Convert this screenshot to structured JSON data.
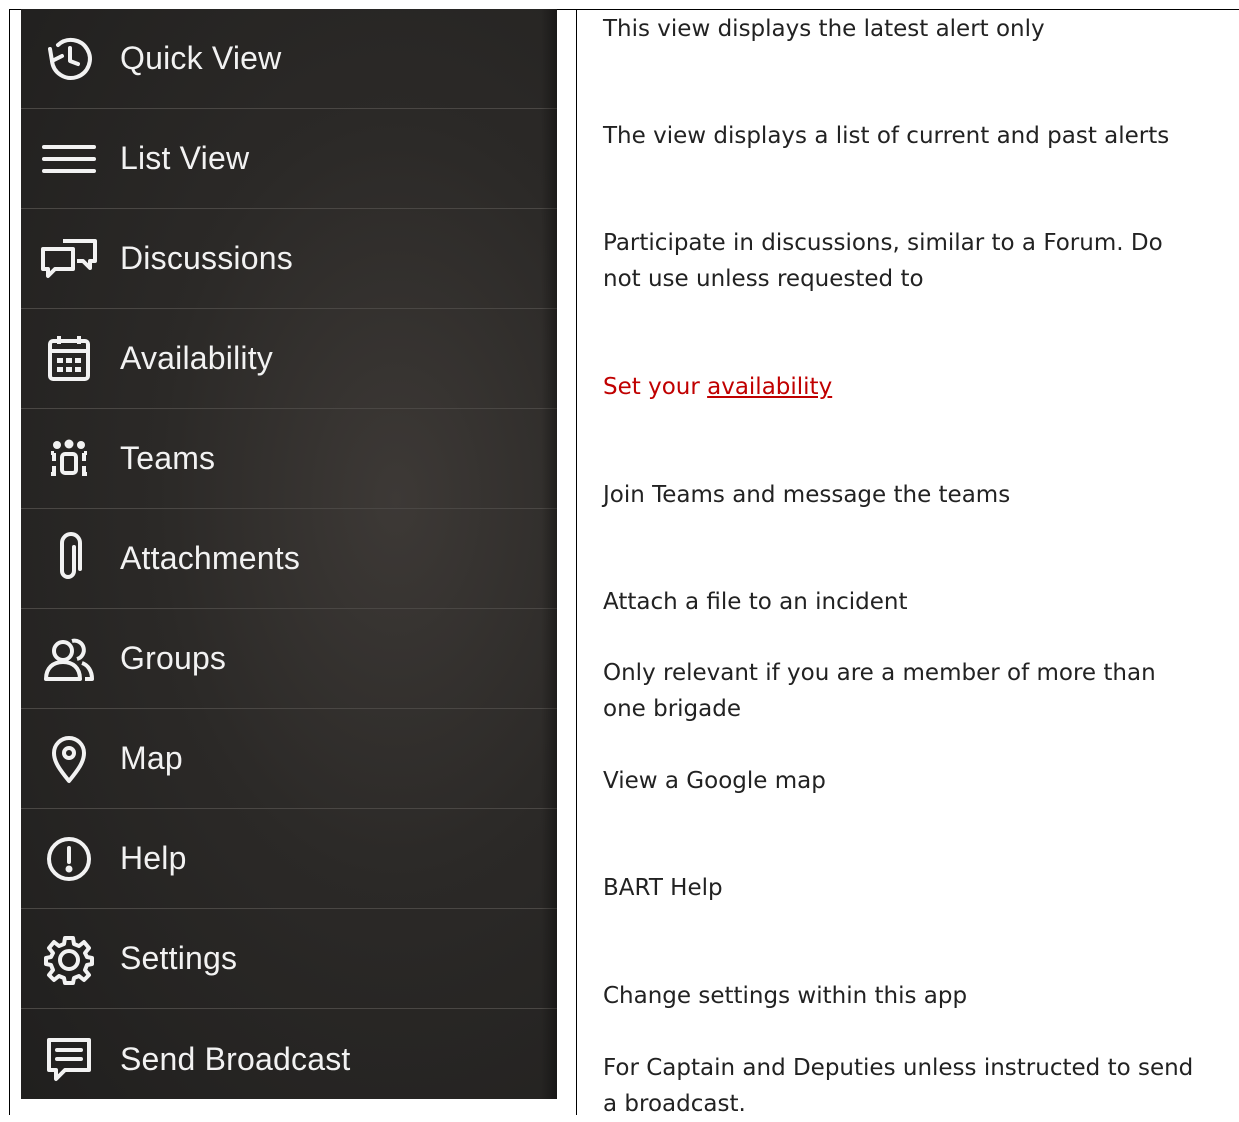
{
  "nav": {
    "items": [
      {
        "label": "Quick View",
        "icon": "history-icon"
      },
      {
        "label": "List View",
        "icon": "menu-lines-icon"
      },
      {
        "label": "Discussions",
        "icon": "chat-bubbles-icon"
      },
      {
        "label": "Availability",
        "icon": "calendar-icon"
      },
      {
        "label": "Teams",
        "icon": "team-icon"
      },
      {
        "label": "Attachments",
        "icon": "paperclip-icon"
      },
      {
        "label": "Groups",
        "icon": "people-icon"
      },
      {
        "label": "Map",
        "icon": "map-pin-icon"
      },
      {
        "label": "Help",
        "icon": "alert-circle-icon"
      },
      {
        "label": "Settings",
        "icon": "gear-icon"
      },
      {
        "label": "Send Broadcast",
        "icon": "message-icon"
      }
    ]
  },
  "descriptions": {
    "quick_view": "This view displays the latest alert only",
    "list_view": "The view displays a list of current and past alerts",
    "discussions_line1": "Participate in discussions, similar to a Forum. Do",
    "discussions_line2": "not use unless requested to",
    "availability_prefix": "Set your ",
    "availability_link": "availability",
    "teams": "Join Teams and message the teams",
    "attachments": "Attach a file to an incident",
    "groups_line1": "Only relevant if you are a member of more than",
    "groups_line2": "one brigade",
    "map": "View a Google map",
    "help": "BART Help",
    "settings": "Change settings within this app",
    "broadcast_line1": "For Captain and Deputies unless instructed to send",
    "broadcast_line2": "a broadcast."
  },
  "colors": {
    "drawer_bg": "#2b2927",
    "nav_text": "#f2f2f2",
    "availability_red": "#c00000"
  }
}
